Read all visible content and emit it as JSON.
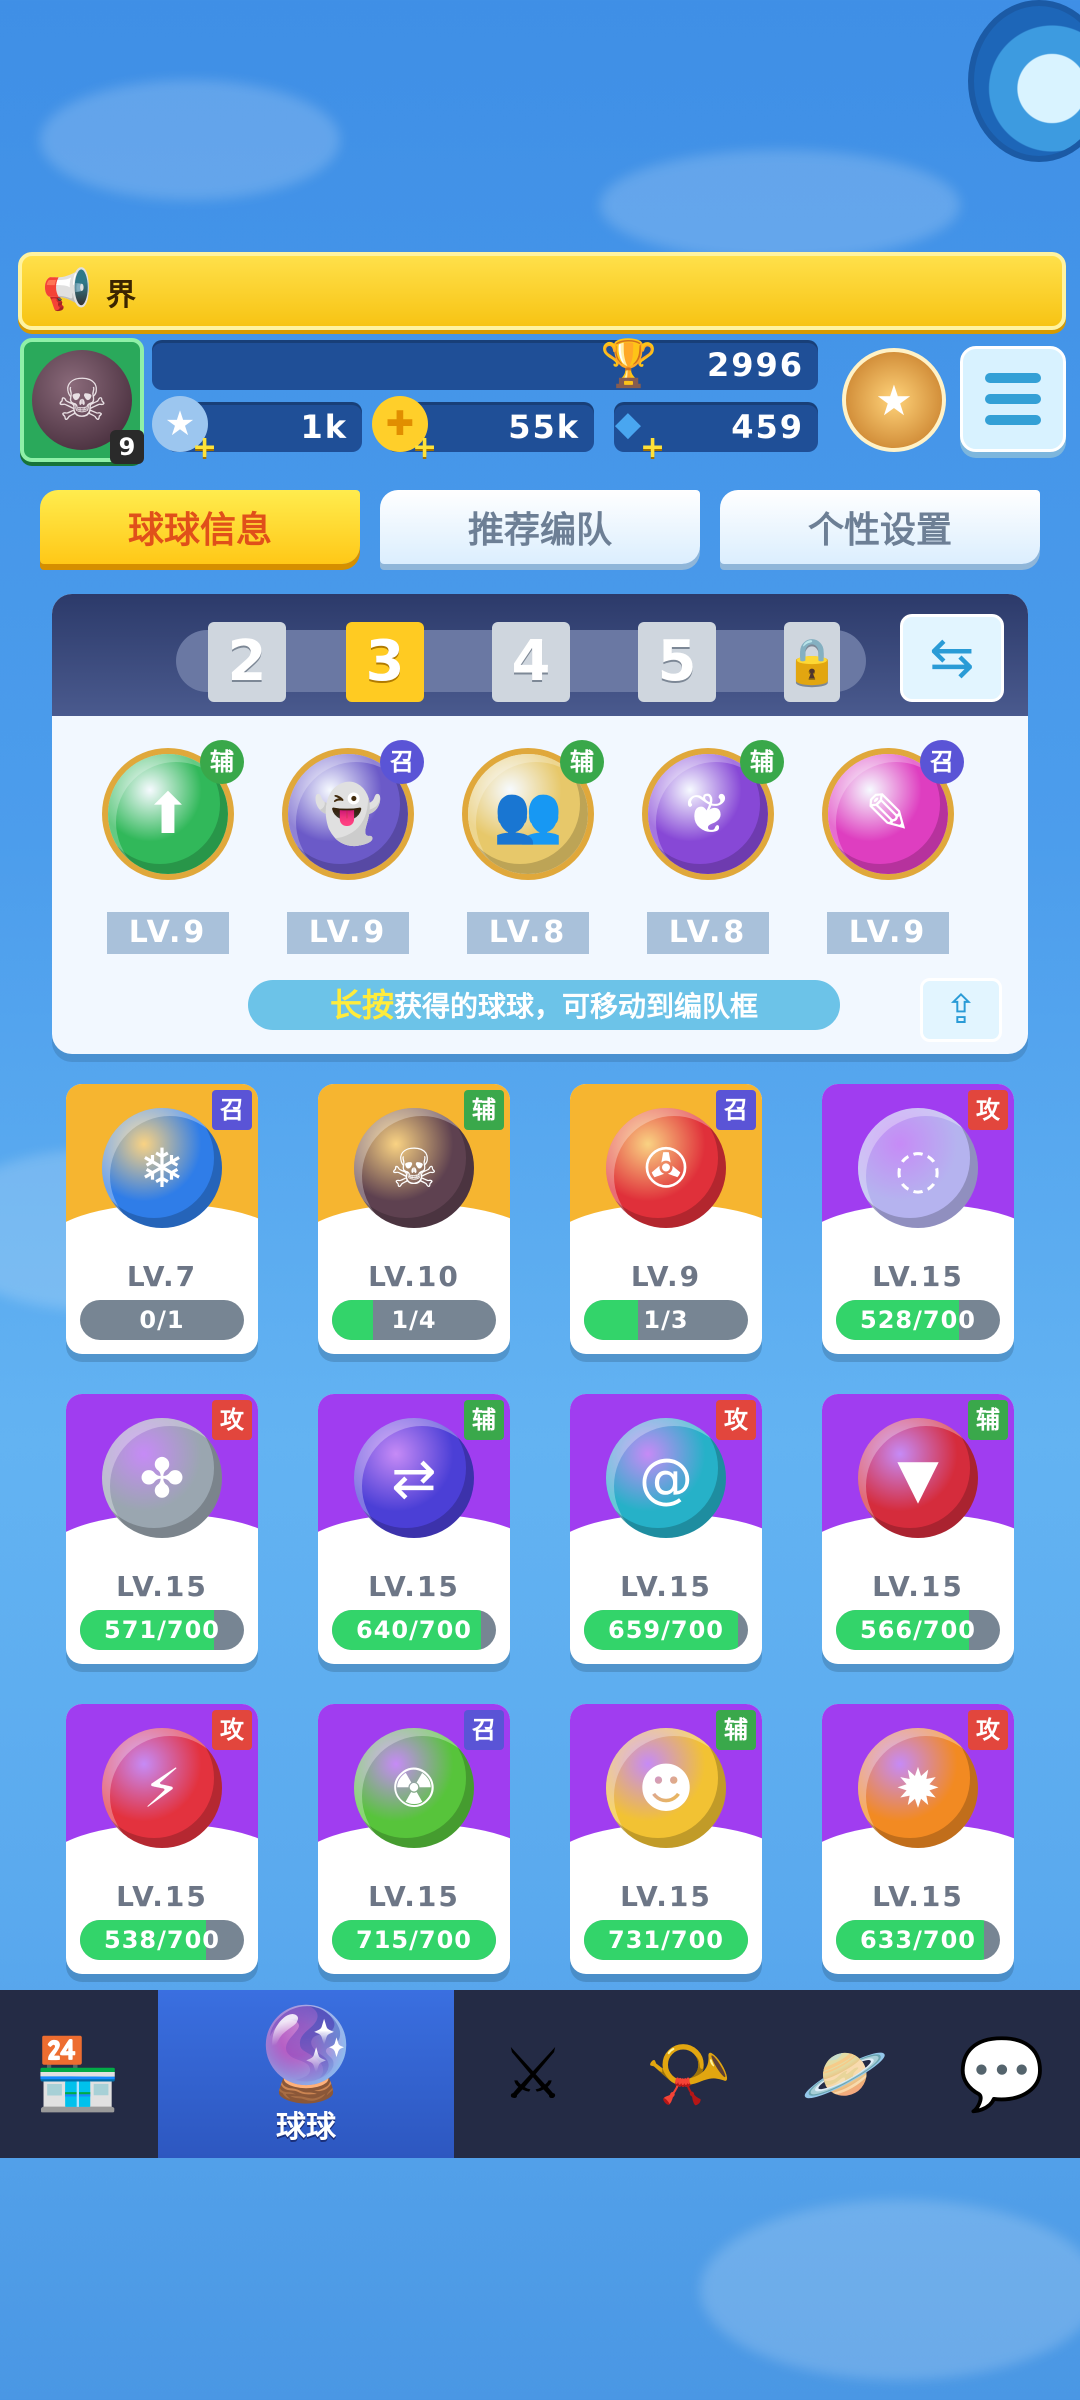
{
  "banner": {
    "icon": "megaphone-icon",
    "text": "界"
  },
  "player": {
    "level": "9",
    "avatar_icon": "skull-icon"
  },
  "resources": {
    "trophies": "2996",
    "stamina": "1k",
    "coins": "55k",
    "gems": "459"
  },
  "top_tabs": [
    "球球信息",
    "推荐编队",
    "个性设置"
  ],
  "team": {
    "slots": [
      "2",
      "3",
      "4",
      "5"
    ],
    "selected_slot": "3",
    "lock_icon": "lock-icon",
    "members": [
      {
        "tag": "辅",
        "level": "LV.9",
        "color": "#31b85a",
        "icon": "up-arrow-icon"
      },
      {
        "tag": "召",
        "level": "LV.9",
        "color": "#6b5ac8",
        "icon": "ghost-icon"
      },
      {
        "tag": "辅",
        "level": "LV.8",
        "color": "#e7c86a",
        "icon": "people-icon"
      },
      {
        "tag": "辅",
        "level": "LV.8",
        "color": "#8748d6",
        "icon": "sprout-icon"
      },
      {
        "tag": "召",
        "level": "LV.9",
        "color": "#de3ec0",
        "icon": "blade-icon"
      }
    ],
    "hint_highlight": "长按",
    "hint_text": "获得的球球，可移动到编队框"
  },
  "cards": [
    {
      "tag": "召",
      "type": "summon",
      "frame": "gold",
      "level": "LV.7",
      "progress": "0/1",
      "fill": 0,
      "color": "#2f7de8",
      "icon": "ice-icon"
    },
    {
      "tag": "辅",
      "type": "assist",
      "frame": "gold",
      "level": "LV.10",
      "progress": "1/4",
      "fill": 0.25,
      "color": "#5e4150",
      "icon": "skull-icon"
    },
    {
      "tag": "召",
      "type": "summon",
      "frame": "gold",
      "level": "LV.9",
      "progress": "1/3",
      "fill": 0.33,
      "color": "#e0303a",
      "icon": "cannon-icon"
    },
    {
      "tag": "攻",
      "type": "atk",
      "frame": "purple",
      "level": "LV.15",
      "progress": "528/700",
      "fill": 0.75,
      "color": "#b5b3ef",
      "icon": "bubbles-icon"
    },
    {
      "tag": "攻",
      "type": "atk",
      "frame": "purple",
      "level": "LV.15",
      "progress": "571/700",
      "fill": 0.82,
      "color": "#9aa6b0",
      "icon": "fan-icon"
    },
    {
      "tag": "辅",
      "type": "assist",
      "frame": "purple",
      "level": "LV.15",
      "progress": "640/700",
      "fill": 0.91,
      "color": "#4b3fd6",
      "icon": "swap-icon"
    },
    {
      "tag": "攻",
      "type": "atk",
      "frame": "purple",
      "level": "LV.15",
      "progress": "659/700",
      "fill": 0.94,
      "color": "#26b1c8",
      "icon": "swirl-icon"
    },
    {
      "tag": "辅",
      "type": "assist",
      "frame": "purple",
      "level": "LV.15",
      "progress": "566/700",
      "fill": 0.81,
      "color": "#d52c3c",
      "icon": "fang-icon"
    },
    {
      "tag": "攻",
      "type": "atk",
      "frame": "purple",
      "level": "LV.15",
      "progress": "538/700",
      "fill": 0.77,
      "color": "#e3323e",
      "icon": "lightning-icon"
    },
    {
      "tag": "召",
      "type": "summon",
      "frame": "purple",
      "level": "LV.15",
      "progress": "715/700",
      "fill": 1,
      "color": "#57c43b",
      "icon": "radiation-icon"
    },
    {
      "tag": "辅",
      "type": "assist",
      "frame": "purple",
      "level": "LV.15",
      "progress": "731/700",
      "fill": 1,
      "color": "#f2c233",
      "icon": "monster-icon"
    },
    {
      "tag": "攻",
      "type": "atk",
      "frame": "purple",
      "level": "LV.15",
      "progress": "633/700",
      "fill": 0.9,
      "color": "#f28a22",
      "icon": "sun-icon"
    }
  ],
  "nav": [
    {
      "icon": "shop-icon",
      "label": ""
    },
    {
      "icon": "ball-collection-icon",
      "label": "球球"
    },
    {
      "icon": "crossed-swords-icon",
      "label": ""
    },
    {
      "icon": "whistle-icon",
      "label": ""
    },
    {
      "icon": "planet-icon",
      "label": ""
    },
    {
      "icon": "chat-heart-icon",
      "label": ""
    }
  ]
}
